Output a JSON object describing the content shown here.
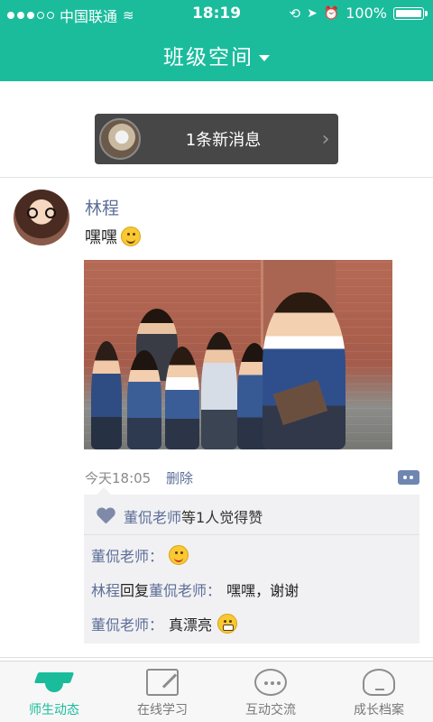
{
  "status_bar": {
    "carrier": "中国联通",
    "time": "18:19",
    "battery": "100%"
  },
  "header": {
    "title": "班级空间"
  },
  "notice": {
    "text": "1条新消息"
  },
  "post": {
    "author": "林程",
    "text": "嘿嘿",
    "time": "今天18:05",
    "delete_label": "删除",
    "likes": {
      "name": "董侃老师",
      "suffix": "等1人觉得赞"
    },
    "comments": [
      {
        "name": "董侃老师",
        "separator": "：",
        "text": ""
      },
      {
        "name": "林程",
        "reply_word": "回复",
        "reply_to": "董侃老师",
        "separator": "：",
        "text": "嘿嘿，谢谢"
      },
      {
        "name": "董侃老师",
        "separator": "：",
        "text": "真漂亮"
      }
    ]
  },
  "tabs": [
    {
      "label": "师生动态",
      "icon": "graduation-cap-icon",
      "active": true
    },
    {
      "label": "在线学习",
      "icon": "edit-icon",
      "active": false
    },
    {
      "label": "互动交流",
      "icon": "chat-icon",
      "active": false
    },
    {
      "label": "成长档案",
      "icon": "profile-icon",
      "active": false
    }
  ],
  "colors": {
    "accent": "#1abc9c",
    "link": "#5d6e98",
    "notice_bg": "#474747"
  }
}
